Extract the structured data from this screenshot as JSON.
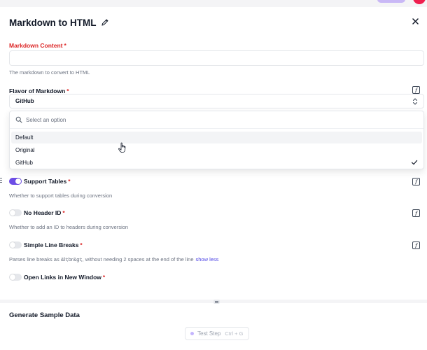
{
  "panel": {
    "title": "Markdown to HTML"
  },
  "fields": {
    "markdown_content": {
      "label": "Markdown Content",
      "required_mark": "*",
      "value": "",
      "help": "The markdown to convert to HTML"
    },
    "flavor": {
      "label": "Flavor of Markdown",
      "required_mark": "*",
      "selected": "GitHub",
      "search_placeholder": "Select an option",
      "options": [
        "Default",
        "Original",
        "GitHub"
      ],
      "hovered_option": "Default"
    },
    "support_tables": {
      "label": "Support Tables",
      "required_mark": "*",
      "enabled": true,
      "help": "Whether to support tables during conversion"
    },
    "no_header_id": {
      "label": "No Header ID",
      "required_mark": "*",
      "enabled": false,
      "help": "Whether to add an ID to headers during conversion"
    },
    "simple_line_breaks": {
      "label": "Simple Line Breaks",
      "required_mark": "*",
      "enabled": false,
      "help": "Parses line breaks as &lt;br&gt;, without needing 2 spaces at the end of the line",
      "help_link": "show less"
    },
    "open_links_new_window": {
      "label": "Open Links in New Window",
      "required_mark": "*",
      "enabled": false
    }
  },
  "fx_icon_glyph": "f",
  "bottom": {
    "title": "Generate Sample Data",
    "test_button": {
      "label": "Test Step",
      "shortcut": "Ctrl + G"
    }
  },
  "colors": {
    "accent": "#6d4de6",
    "error": "#dc2626",
    "link": "#4f46e5"
  }
}
